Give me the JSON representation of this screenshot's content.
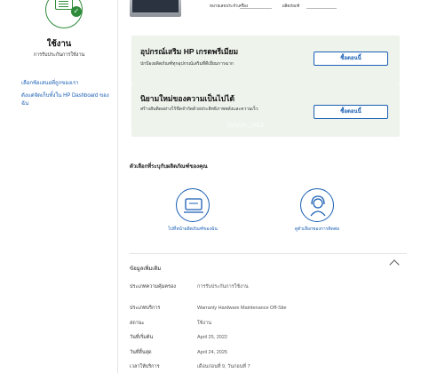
{
  "sidebar": {
    "status_title": "ใช้งาน",
    "status_subtitle": "การรับประกันการใช้งาน",
    "link1": "เลือกซ้อเสนอที่ถูกของเรา",
    "link2": "ดังแต่จัดเก็บทั้งใน HP Dashboard ของฉัน"
  },
  "top": {
    "field1": "หมายเลขประจำเครื่อง",
    "field2": "ผลิตภัณฑ์"
  },
  "promos": [
    {
      "title": "อุปกรณ์เสริม HP เกรดพรีเมียม",
      "desc": "ปกป้องผลิตภัณฑ์ทุกอุปกรณ์เสริมที่ดีเยี่ยมการฉาก",
      "button": "ซื้อตอนนี้"
    },
    {
      "title": "นิยามใหม่ของความเป็นไปได้",
      "desc": "สร้างสันติดอย่างไร้ขีดจำกัดด้วยประสิทธิภาพพลังและความเร็ว",
      "button": "ซื้อตอนนี้"
    }
  ],
  "watermark": "junior_ocz",
  "options": {
    "title": "ตัวเลือกที่ระบุกับผลิตภัณฑ์ของคุณ",
    "items": [
      {
        "label": "ไปที่หน้าผลิตภัณฑ์ของฉัน",
        "icon": "product-page-icon"
      },
      {
        "label": "ดูตัวเลือกของการติดต่อ",
        "icon": "support-agent-icon"
      }
    ]
  },
  "info": {
    "header": "ข้อมูลเพิ่มเติม",
    "rows": [
      {
        "label": "ประเภทความคุ้มครอง",
        "value": "การรับประกันการใช้งาน"
      },
      {
        "label": "ประเภทบริการ",
        "value": "Warranty Hardware Maintenance Off-Site"
      },
      {
        "label": "สถานะ",
        "value": "ใช้งาน"
      },
      {
        "label": "วันที่เริ่มต้น",
        "value": "April 25, 2022"
      },
      {
        "label": "วันที่สิ้นสุด",
        "value": "April 24, 2025"
      },
      {
        "label": "เวลาให้บริการ",
        "value": "เดือนก่อนที่ 9, วันก่อนที่ 7"
      }
    ]
  },
  "colors": {
    "accent": "#1a5fb4",
    "status_green": "#2e8b3a",
    "promo_bg": "#eef3ec"
  }
}
